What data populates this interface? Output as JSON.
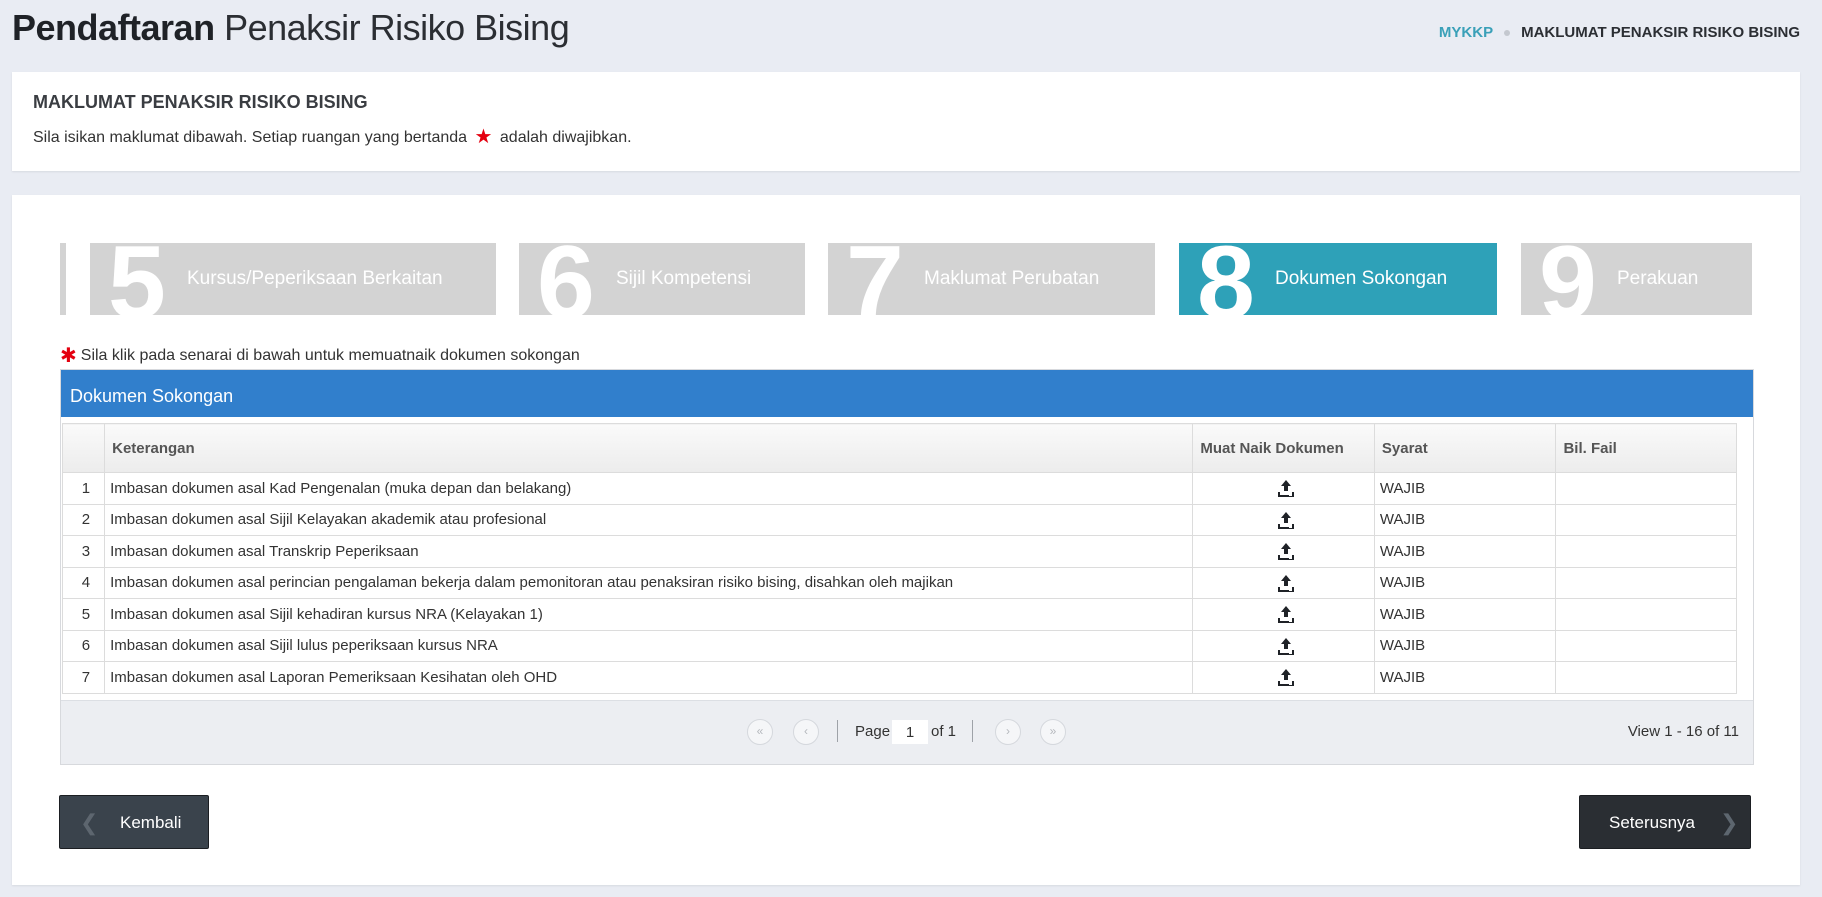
{
  "header": {
    "title_bold": "Pendaftaran",
    "title_light": "Penaksir Risiko Bising",
    "breadcrumb": {
      "link": "MYKKP",
      "current": "MAKLUMAT PENAKSIR RISIKO BISING"
    }
  },
  "info": {
    "title": "MAKLUMAT PENAKSIR RISIKO BISING",
    "text_before": "Sila isikan maklumat dibawah. Setiap ruangan yang bertanda",
    "text_after": "adalah diwajibkan."
  },
  "steps": [
    {
      "number": "5",
      "label": "Kursus/Peperiksaan Berkaitan",
      "active": false
    },
    {
      "number": "6",
      "label": "Sijil Kompetensi",
      "active": false
    },
    {
      "number": "7",
      "label": "Maklumat Perubatan",
      "active": false
    },
    {
      "number": "8",
      "label": "Dokumen Sokongan",
      "active": true
    },
    {
      "number": "9",
      "label": "Perakuan",
      "active": false
    }
  ],
  "note": "Sila klik pada senarai di bawah untuk memuatnaik dokumen sokongan",
  "grid": {
    "caption": "Dokumen Sokongan",
    "columns": [
      "",
      "Keterangan",
      "Muat Naik Dokumen",
      "Syarat",
      "Bil. Fail"
    ],
    "rows": [
      {
        "no": "1",
        "keterangan": "Imbasan dokumen asal Kad Pengenalan (muka depan dan belakang)",
        "syarat": "WAJIB",
        "bil_fail": ""
      },
      {
        "no": "2",
        "keterangan": "Imbasan dokumen asal Sijil Kelayakan akademik atau profesional",
        "syarat": "WAJIB",
        "bil_fail": ""
      },
      {
        "no": "3",
        "keterangan": "Imbasan dokumen asal Transkrip Peperiksaan",
        "syarat": "WAJIB",
        "bil_fail": ""
      },
      {
        "no": "4",
        "keterangan": "Imbasan dokumen asal perincian pengalaman bekerja dalam pemonitoran atau penaksiran risiko bising, disahkan oleh majikan",
        "syarat": "WAJIB",
        "bil_fail": ""
      },
      {
        "no": "5",
        "keterangan": "Imbasan dokumen asal Sijil kehadiran kursus NRA (Kelayakan 1)",
        "syarat": "WAJIB",
        "bil_fail": ""
      },
      {
        "no": "6",
        "keterangan": "Imbasan dokumen asal Sijil lulus peperiksaan kursus NRA",
        "syarat": "WAJIB",
        "bil_fail": ""
      },
      {
        "no": "7",
        "keterangan": "Imbasan dokumen asal Laporan Pemeriksaan Kesihatan oleh OHD",
        "syarat": "WAJIB",
        "bil_fail": ""
      }
    ],
    "pager": {
      "page_label": "Page",
      "page_value": "1",
      "of_label": "of 1",
      "view_text": "View 1 - 16 of 11"
    }
  },
  "buttons": {
    "back": "Kembali",
    "next": "Seterusnya"
  },
  "colors": {
    "accent": "#2ea1b8",
    "grid_caption": "#317fcc",
    "required": "#e4000f",
    "button_dark": "#2a2e33"
  }
}
